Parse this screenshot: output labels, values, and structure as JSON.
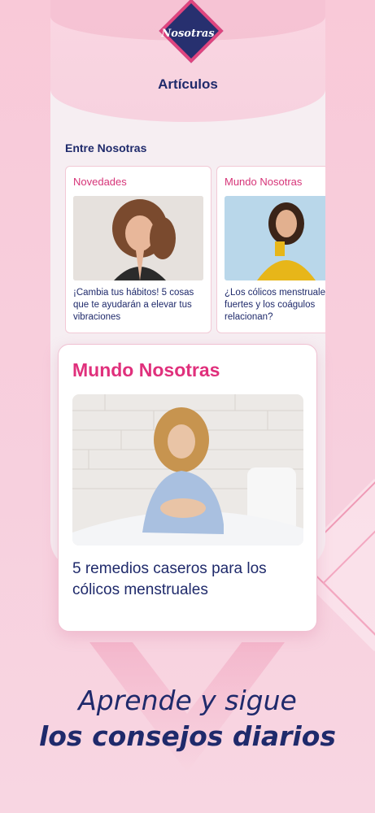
{
  "colors": {
    "brand_pink": "#e0307c",
    "navy": "#1f2a6b",
    "background": "#f9c9d8"
  },
  "logo": {
    "text": "Nosotras"
  },
  "screen": {
    "title": "Artículos"
  },
  "section": {
    "title": "Entre Nosotras"
  },
  "cards": [
    {
      "category": "Novedades",
      "text": "¡Cambia tus hábitos! 5 cosas que te ayudarán a elevar tus vibraciones",
      "image": "woman-praying-photo"
    },
    {
      "category": "Mundo Nosotras",
      "text": "¿Los cólicos menstruales fuertes y los coágulos relacionan?",
      "image": "woman-thinking-yellow-sweater-photo"
    }
  ],
  "featured": {
    "category": "Mundo Nosotras",
    "text": "5 remedios caseros para los cólicos menstruales",
    "image": "woman-in-bed-with-cramps-photo"
  },
  "tagline": {
    "line1": "Aprende y sigue",
    "line2": "los consejos diarios"
  }
}
